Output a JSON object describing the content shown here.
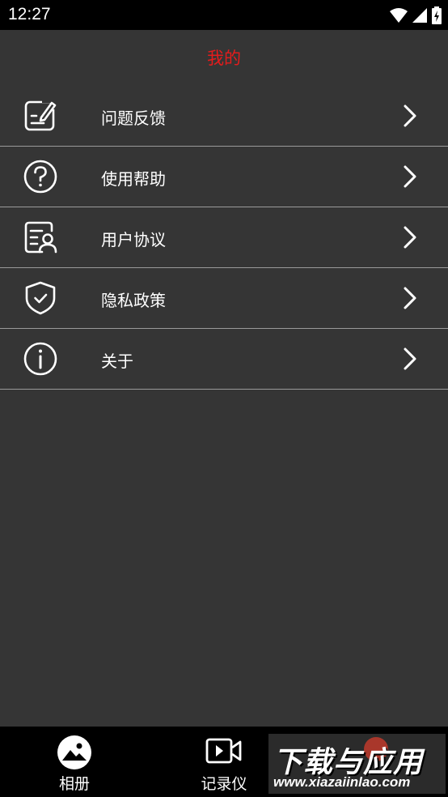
{
  "status_bar": {
    "time": "12:27"
  },
  "header": {
    "title": "我的"
  },
  "menu": {
    "items": [
      {
        "label": "问题反馈",
        "icon": "feedback-edit-icon"
      },
      {
        "label": "使用帮助",
        "icon": "help-circle-icon"
      },
      {
        "label": "用户协议",
        "icon": "user-agreement-icon"
      },
      {
        "label": "隐私政策",
        "icon": "privacy-shield-icon"
      },
      {
        "label": "关于",
        "icon": "info-circle-icon"
      }
    ]
  },
  "tabbar": {
    "tabs": [
      {
        "label": "相册",
        "icon": "album-icon"
      },
      {
        "label": "记录仪",
        "icon": "video-recorder-icon"
      }
    ]
  },
  "watermark": {
    "brand": "下载与应用",
    "url": "www.xiazaiinlao.com"
  },
  "colors": {
    "accent_title": "#e51c1c",
    "background": "#353535",
    "bars": "#000000"
  }
}
